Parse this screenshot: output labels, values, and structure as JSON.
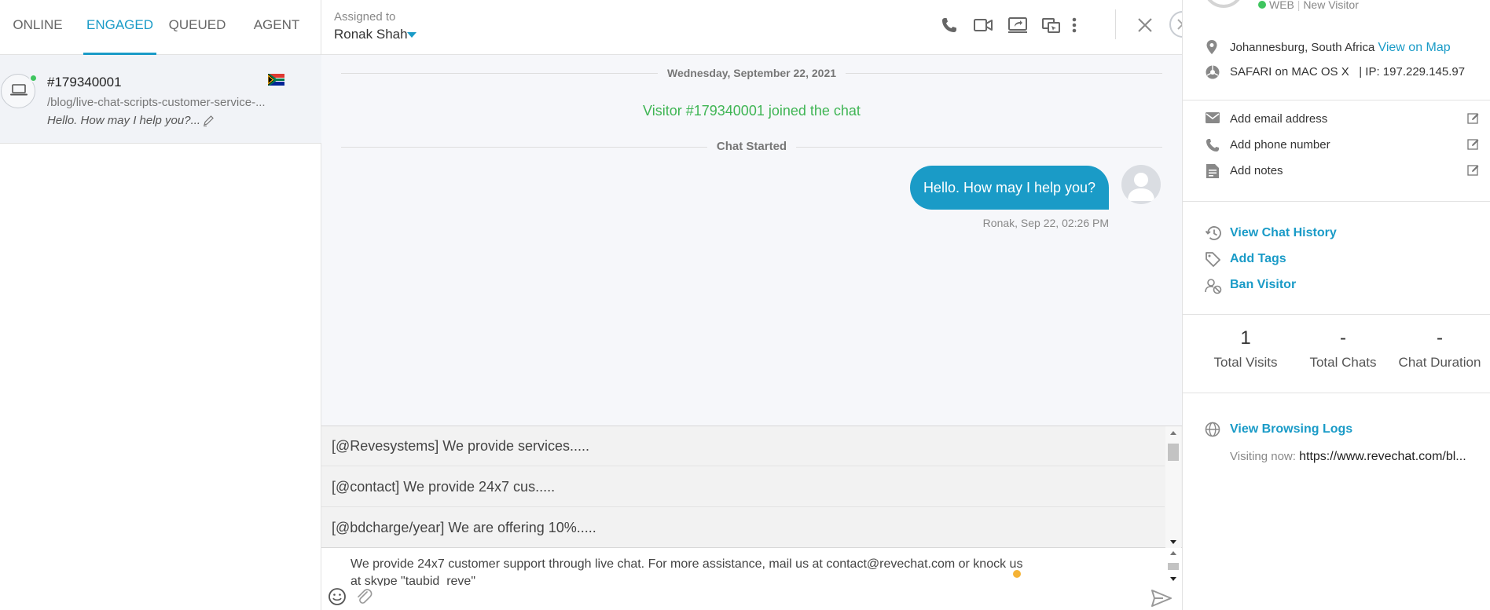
{
  "tabs": {
    "online": "ONLINE",
    "engaged": "ENGAGED",
    "queued": "QUEUED",
    "agent": "AGENT"
  },
  "visitor_item": {
    "id": "#179340001",
    "url": "/blog/live-chat-scripts-customer-service-...",
    "last_message": "Hello. How may I help you?..."
  },
  "header": {
    "assigned_label": "Assigned to",
    "assigned_name": "Ronak Shah"
  },
  "chat": {
    "date": "Wednesday, September 22, 2021",
    "joined": "Visitor #179340001 joined the chat",
    "started": "Chat Started",
    "message_text": "Hello. How may I help you?",
    "message_meta": "Ronak, Sep 22, 02:26 PM"
  },
  "canned_responses": [
    "[@Revesystems] We provide services.....",
    "[@contact] We provide 24x7 cus.....",
    "[@bdcharge/year] We are offering 10%....."
  ],
  "composer": {
    "text": "We provide 24x7 customer support through live chat. For more assistance, mail us at contact@revechat.com or knock us at skype \"taubid_reve\""
  },
  "visitor_info": {
    "channel": "WEB",
    "visitor_type": "New Visitor",
    "location": "Johannesburg, South Africa",
    "view_map": "View on Map",
    "browser": "SAFARI on MAC OS X",
    "ip": "IP: 197.229.145.97",
    "add_email": "Add email address",
    "add_phone": "Add phone number",
    "add_notes": "Add notes",
    "view_history": "View Chat History",
    "add_tags": "Add Tags",
    "ban_visitor": "Ban Visitor",
    "stats": {
      "visits_value": "1",
      "visits_label": "Total Visits",
      "chats_value": "-",
      "chats_label": "Total Chats",
      "duration_value": "-",
      "duration_label": "Chat Duration"
    },
    "browsing_logs": "View Browsing Logs",
    "visiting_label": "Visiting now:",
    "visiting_url": "https://www.revechat.com/bl..."
  },
  "colors": {
    "accent": "#1a9bc7",
    "online": "#3fc55f",
    "joined_text": "#3fb554"
  }
}
